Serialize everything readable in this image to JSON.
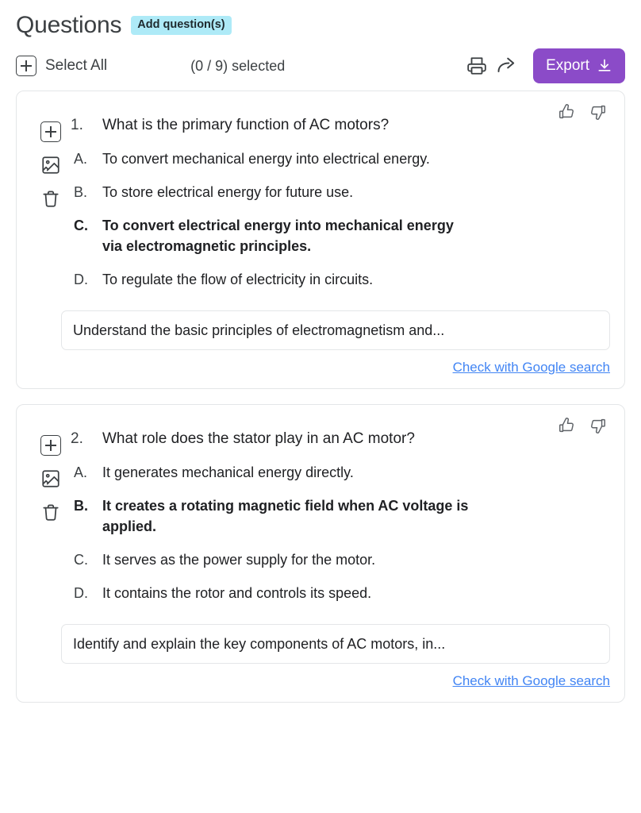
{
  "header": {
    "title": "Questions",
    "add_badge_label": "Add question(s)"
  },
  "toolbar": {
    "select_all_label": "Select All",
    "select_all_icon": "plus-box-icon",
    "selected_count": "(0 / 9) selected",
    "print_icon": "print-icon",
    "share_icon": "share-arrow-icon",
    "export_label": "Export",
    "export_icon": "download-icon",
    "export_color": "#8B4BC8"
  },
  "card_actions": {
    "add_icon": "plus-box-icon",
    "image_icon": "image-icon",
    "delete_icon": "trash-icon",
    "thumbs_up_icon": "thumbs-up-icon",
    "thumbs_down_icon": "thumbs-down-icon"
  },
  "link_color": "#4285f4",
  "questions": [
    {
      "number": "1.",
      "text": "What is the primary function of AC motors?",
      "options": [
        {
          "letter": "A.",
          "text": "To convert mechanical energy into electrical energy.",
          "correct": false
        },
        {
          "letter": "B.",
          "text": "To store electrical energy for future use.",
          "correct": false
        },
        {
          "letter": "C.",
          "text": "To convert electrical energy into mechanical energy via electromagnetic principles.",
          "correct": true
        },
        {
          "letter": "D.",
          "text": "To regulate the flow of electricity in circuits.",
          "correct": false
        }
      ],
      "hint": "Understand the basic principles of electromagnetism and...",
      "google_link": "Check with Google search"
    },
    {
      "number": "2.",
      "text": "What role does the stator play in an AC motor?",
      "options": [
        {
          "letter": "A.",
          "text": "It generates mechanical energy directly.",
          "correct": false
        },
        {
          "letter": "B.",
          "text": "It creates a rotating magnetic field when AC voltage is applied.",
          "correct": true
        },
        {
          "letter": "C.",
          "text": "It serves as the power supply for the motor.",
          "correct": false
        },
        {
          "letter": "D.",
          "text": "It contains the rotor and controls its speed.",
          "correct": false
        }
      ],
      "hint": "Identify and explain the key components of AC motors, in...",
      "google_link": "Check with Google search"
    }
  ]
}
